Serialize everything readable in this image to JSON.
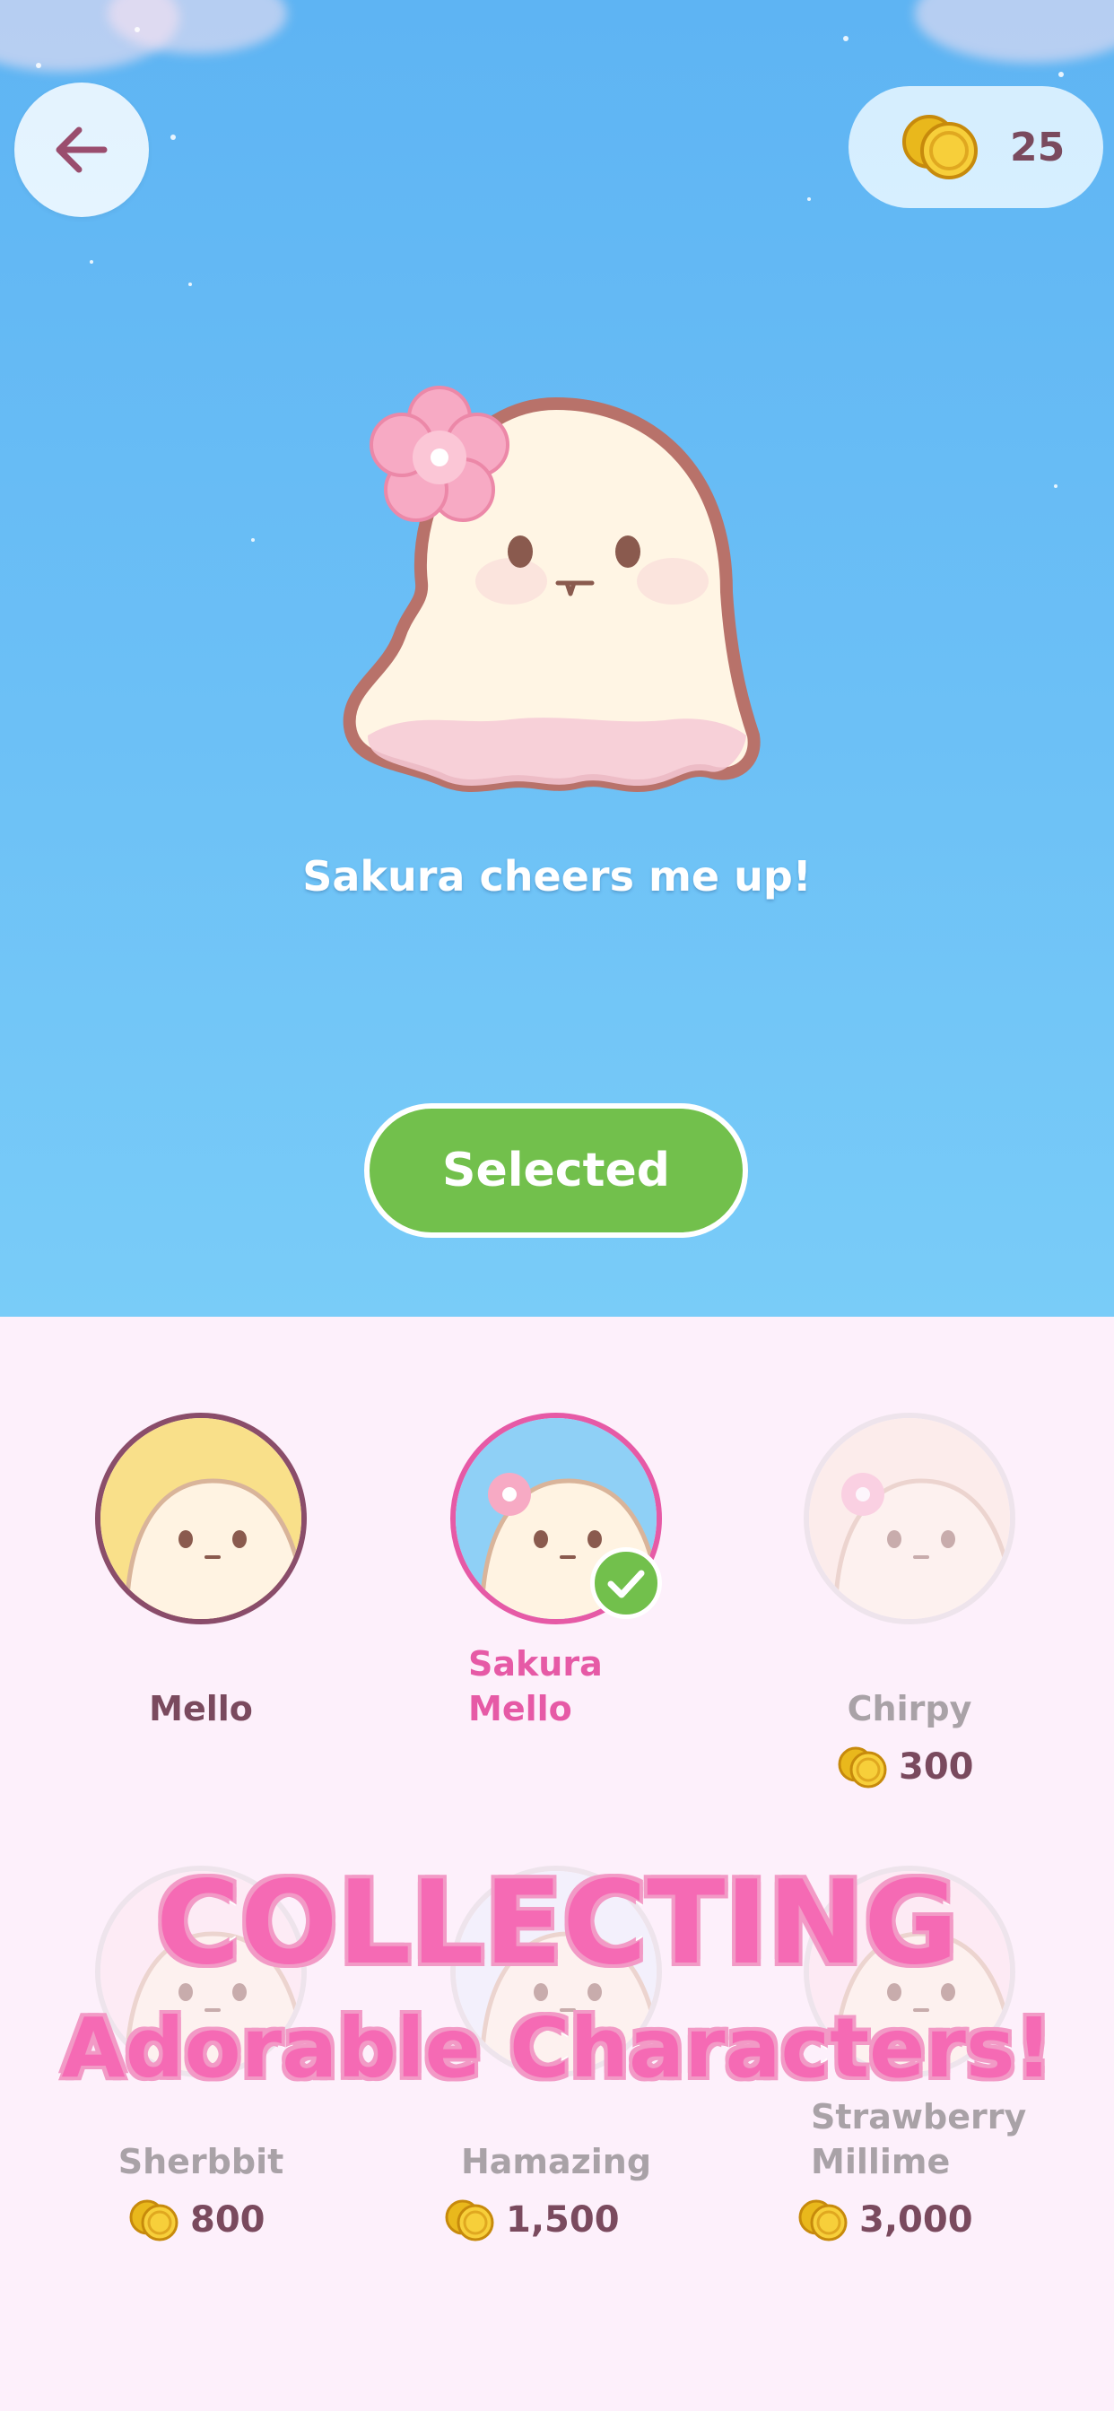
{
  "header": {
    "back_icon": "arrow-left-icon",
    "coin_icon": "coin-stack-icon",
    "coin_count": "25"
  },
  "hero": {
    "tagline": "Sakura cheers me up!",
    "action_label": "Selected"
  },
  "characters": [
    {
      "name": "Mello",
      "price": "",
      "state": "owned"
    },
    {
      "name": "Sakura\nMello",
      "price": "",
      "state": "selected"
    },
    {
      "name": "Chirpy",
      "price": "300",
      "state": "locked"
    },
    {
      "name": "Sherbbit",
      "price": "800",
      "state": "locked"
    },
    {
      "name": "Hamazing",
      "price": "1,500",
      "state": "locked"
    },
    {
      "name": "Strawberry\nMillime",
      "price": "3,000",
      "state": "locked"
    }
  ],
  "banner": {
    "line1": "COLLECTING",
    "line2": "Adorable Characters!"
  },
  "colors": {
    "sky": "#6cc0f6",
    "selected_green": "#72c04c",
    "accent_pink": "#f56ab4",
    "text_plum": "#7a4a5e",
    "panel_bg": "#fdf0fb"
  }
}
